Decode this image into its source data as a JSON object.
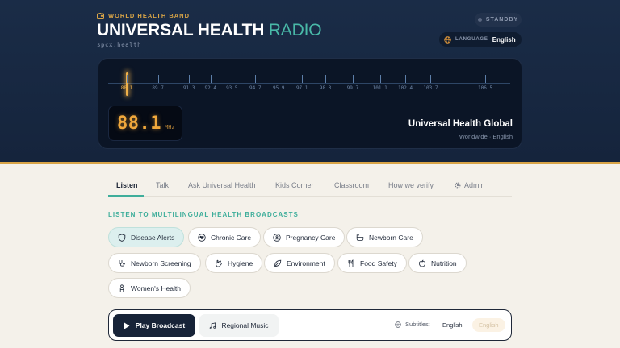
{
  "header": {
    "band_label": "WORLD HEALTH BAND",
    "title_main": "UNIVERSAL HEALTH",
    "title_accent": "RADIO",
    "domain": "spcx.health",
    "status_label": "STANDBY",
    "language_label": "LANGUAGE",
    "language_value": "English"
  },
  "colors": {
    "header_bg": "#1a2c47",
    "accent_gold": "#d8a447",
    "accent_teal": "#3fae9b",
    "page_bg": "#f4f1ea"
  },
  "radio": {
    "ticks": [
      "88.1",
      "89.7",
      "91.3",
      "92.4",
      "93.5",
      "94.7",
      "95.9",
      "97.1",
      "98.3",
      "99.7",
      "101.1",
      "102.4",
      "103.7",
      "106.5"
    ],
    "active_frequency": "88.1",
    "frequency_display": "88.1",
    "frequency_unit": "MHz",
    "station_name": "Universal Health Global",
    "station_detail": "Worldwide · English"
  },
  "tabs": [
    {
      "label": "Listen",
      "active": true
    },
    {
      "label": "Talk",
      "active": false
    },
    {
      "label": "Ask Universal Health",
      "active": false
    },
    {
      "label": "Kids Corner",
      "active": false
    },
    {
      "label": "Classroom",
      "active": false
    },
    {
      "label": "How we verify",
      "active": false
    },
    {
      "label": "Admin",
      "active": false,
      "icon": "gear-icon"
    }
  ],
  "section_label": "LISTEN TO MULTILINGUAL HEALTH BROADCASTS",
  "categories": [
    {
      "label": "Disease Alerts",
      "icon": "shield-icon",
      "active": true
    },
    {
      "label": "Chronic Care",
      "icon": "heart-icon",
      "active": false
    },
    {
      "label": "Pregnancy Care",
      "icon": "baby-icon",
      "active": false
    },
    {
      "label": "Newborn Care",
      "icon": "cradle-icon",
      "active": false
    },
    {
      "label": "Newborn Screening",
      "icon": "stethoscope-icon",
      "active": false
    },
    {
      "label": "Hygiene",
      "icon": "hand-icon",
      "active": false
    },
    {
      "label": "Environment",
      "icon": "leaf-icon",
      "active": false
    },
    {
      "label": "Food Safety",
      "icon": "utensils-icon",
      "active": false
    },
    {
      "label": "Nutrition",
      "icon": "apple-icon",
      "active": false
    },
    {
      "label": "Women's Health",
      "icon": "person-icon",
      "active": false
    }
  ],
  "player": {
    "play_label": "Play Broadcast",
    "music_label": "Regional Music",
    "subtitles_label": "Subtitles:",
    "subtitle_languages": [
      "English",
      "English"
    ]
  }
}
